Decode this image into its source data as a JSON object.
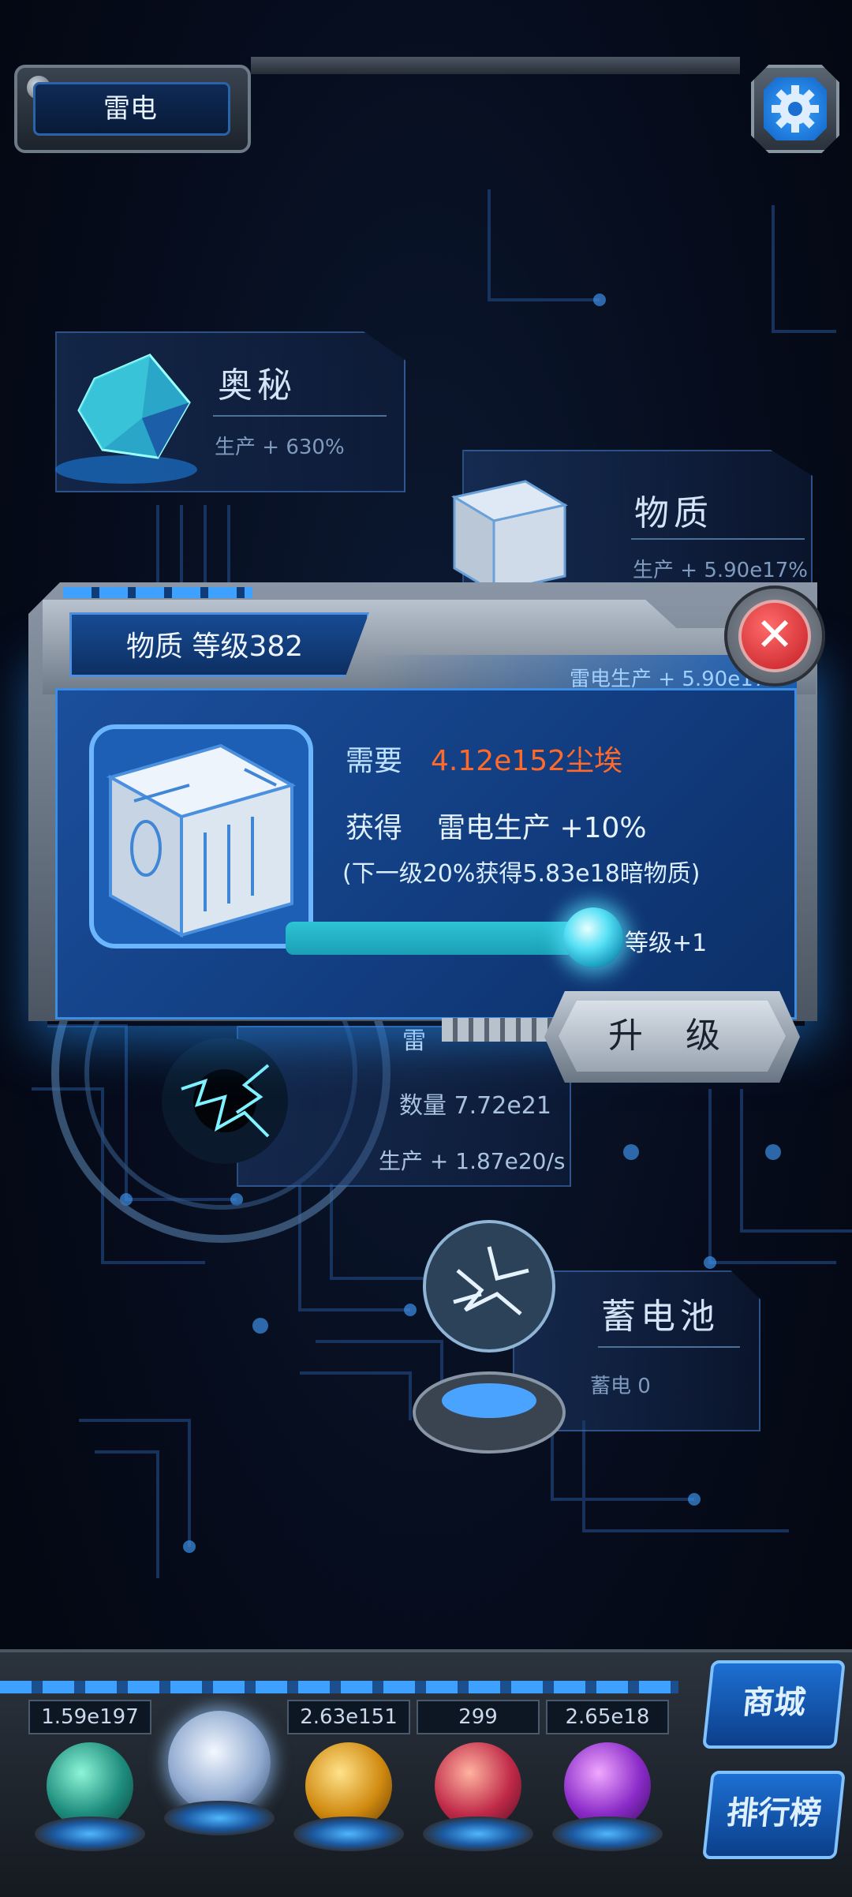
{
  "header": {
    "title": "雷电",
    "settings_icon": "gear-icon"
  },
  "buildings": {
    "mystery": {
      "name": "奥秘",
      "stat": "生产 + 630%"
    },
    "matter": {
      "name": "物质",
      "stat": "生产 + 5.90e17%"
    },
    "thunder": {
      "name_partial": "雷",
      "count": "数量 7.72e21",
      "production": "生产 + 1.87e20/s"
    },
    "battery": {
      "name": "蓄电池",
      "stat": "蓄电 0"
    }
  },
  "dialog": {
    "title": "物质  等级382",
    "subtitle": "雷电生产 + 5.90e17%",
    "requirement_label": "需要",
    "requirement_value": "4.12e152尘埃",
    "gain_label": "获得",
    "gain_value": "雷电生产 +10%",
    "next_level_note": "(下一级20%获得5.83e18暗物质)",
    "slider_label": "等级+1",
    "slider_fraction": 1.0,
    "upgrade_button": "升 级",
    "close_icon": "close-icon"
  },
  "resources": [
    {
      "value": "1.59e197",
      "color": "#2fb7a0"
    },
    {
      "value": "",
      "color": "#c9d6ea"
    },
    {
      "value": "2.63e151",
      "color": "#e0a020"
    },
    {
      "value": "299",
      "color": "#d23a5a"
    },
    {
      "value": "2.65e18",
      "color": "#8a3ad0"
    }
  ],
  "side_buttons": {
    "shop": "商城",
    "leaderboard": "排行榜"
  }
}
